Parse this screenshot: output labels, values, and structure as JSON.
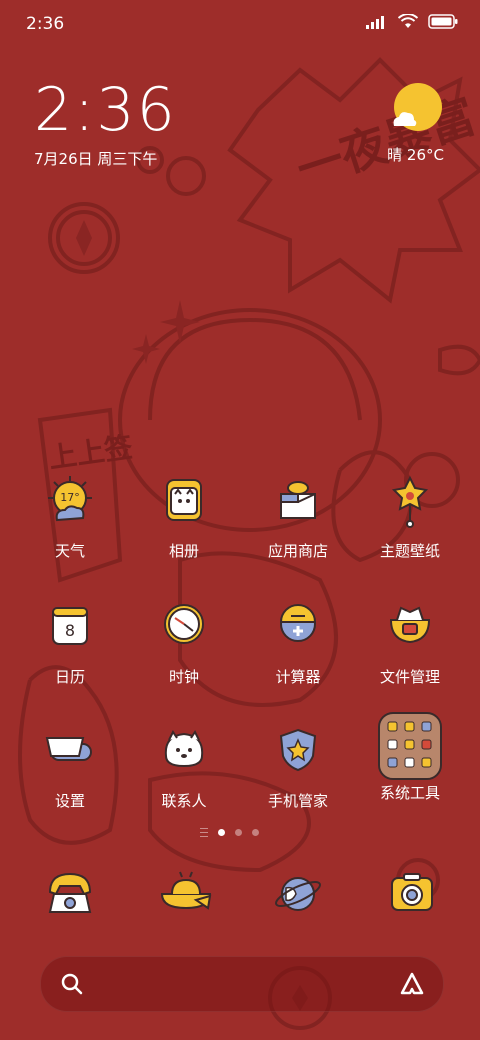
{
  "status_bar": {
    "time": "2:36",
    "icons": [
      "signal-icon",
      "wifi-icon",
      "battery-icon"
    ]
  },
  "clock_widget": {
    "time": "2:36",
    "date": "7月26日 周三下午"
  },
  "weather_widget": {
    "icon": "sunny-cloudy-icon",
    "text": "晴 26°C"
  },
  "wallpaper": {
    "text_banner": "一夜暴富",
    "text_scroll": "上上签"
  },
  "apps": [
    {
      "label": "天气",
      "icon": "weather-app-icon",
      "badge": "17°"
    },
    {
      "label": "相册",
      "icon": "gallery-icon"
    },
    {
      "label": "应用商店",
      "icon": "app-store-icon"
    },
    {
      "label": "主题壁纸",
      "icon": "themes-icon"
    },
    {
      "label": "日历",
      "icon": "calendar-icon",
      "day": "8"
    },
    {
      "label": "时钟",
      "icon": "clock-icon"
    },
    {
      "label": "计算器",
      "icon": "calculator-icon"
    },
    {
      "label": "文件管理",
      "icon": "file-manager-icon"
    },
    {
      "label": "设置",
      "icon": "settings-icon"
    },
    {
      "label": "联系人",
      "icon": "contacts-icon"
    },
    {
      "label": "手机管家",
      "icon": "security-icon"
    },
    {
      "label": "系统工具",
      "icon": "system-tools-folder-icon"
    }
  ],
  "page_indicator": {
    "pages": 3,
    "active": 1
  },
  "dock": [
    {
      "icon": "phone-icon"
    },
    {
      "icon": "messages-icon"
    },
    {
      "icon": "browser-icon"
    },
    {
      "icon": "camera-icon"
    }
  ],
  "search_bar": {
    "left_icon": "search-icon",
    "right_icon": "app-vault-icon"
  },
  "colors": {
    "background": "#9e2d2a",
    "accent_yellow": "#f5c330",
    "icon_outline": "#3a2a2a"
  }
}
